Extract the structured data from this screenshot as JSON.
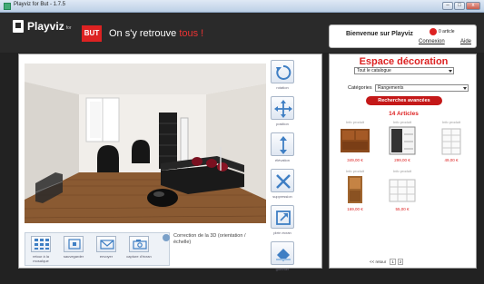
{
  "window": {
    "title": "Playviz for But - 1.7.5",
    "buttons": [
      "–",
      "□",
      "x"
    ]
  },
  "header": {
    "logo_name": "Playviz",
    "logo_sub": "for",
    "brand_badge": "BUT",
    "slogan_main": "On s'y retrouve",
    "slogan_accent": "tous !"
  },
  "welcome": {
    "greeting": "Bienvenue sur Playviz",
    "cart_count": "0 article",
    "login": "Connexion",
    "help": "Aide"
  },
  "tools": [
    {
      "label": "rotation",
      "icon": "rotation-icon"
    },
    {
      "label": "position",
      "icon": "position-arrows-icon"
    },
    {
      "label": "élévation",
      "icon": "elevation-arrows-icon"
    },
    {
      "label": "suppression",
      "icon": "delete-x-icon"
    },
    {
      "label": "plein écran",
      "icon": "fullscreen-icon"
    },
    {
      "label": "gommer",
      "icon": "eraser-icon"
    }
  ],
  "bottom_tools": [
    {
      "label": "retour à la mosaïque",
      "icon": "mosaic-grid-icon"
    },
    {
      "label": "sauvegarder",
      "icon": "save-icon"
    },
    {
      "label": "envoyer",
      "icon": "envelope-icon"
    },
    {
      "label": "capture d'écran",
      "icon": "camera-icon"
    }
  ],
  "correction": {
    "text": "Correction de la 3D (orientation / échelle)"
  },
  "catalog": {
    "title": "Espace décoration",
    "catalogue_select": "Tout le catalogue",
    "category_label": "Catégories",
    "category_select": "Rangements",
    "advanced_search": "Recherches avancées",
    "article_count": "14 Articles",
    "products": [
      {
        "info": "Info produit",
        "price": "349,00 €"
      },
      {
        "info": "Info produit",
        "price": "299,00 €"
      },
      {
        "info": "Info produit",
        "price": "49,00 €"
      },
      {
        "info": "Info produit",
        "price": "169,00 €"
      },
      {
        "info": "Info produit",
        "price": "55,00 €"
      }
    ],
    "pager": {
      "back": "<< retour",
      "pages": [
        "1",
        "2"
      ]
    }
  }
}
